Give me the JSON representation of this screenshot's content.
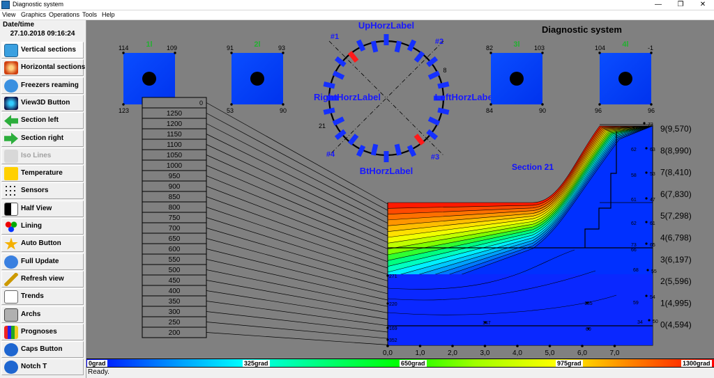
{
  "window": {
    "title": "Diagnostic system",
    "minimize": "—",
    "restore": "❐",
    "close": "✕"
  },
  "menu": [
    "View",
    "Graphics",
    "Operations",
    "Tools",
    "Help"
  ],
  "sidebar": {
    "datetime_label": "Date/time",
    "datetime_value": "27.10.2018 09:16:24",
    "buttons": [
      {
        "label": "Vertical sections",
        "icon": "vertical-sections-icon",
        "pressed": true
      },
      {
        "label": "Horizontal sections",
        "icon": "horizontal-sections-icon"
      },
      {
        "label": "Freezers reaming",
        "icon": "freezers-icon"
      },
      {
        "label": "View3D Button",
        "icon": "view3d-icon"
      },
      {
        "label": "Section left",
        "icon": "arrow-left-icon"
      },
      {
        "label": "Section right",
        "icon": "arrow-right-icon"
      },
      {
        "label": "Iso Lines",
        "icon": "iso-lines-icon",
        "disabled": true
      },
      {
        "label": "Temperature",
        "icon": "temperature-icon"
      },
      {
        "label": "Sensors",
        "icon": "sensors-icon"
      },
      {
        "label": "Half View",
        "icon": "half-view-icon"
      },
      {
        "label": "Lining",
        "icon": "lining-icon"
      },
      {
        "label": "Auto Button",
        "icon": "star-icon"
      },
      {
        "label": "Full Update",
        "icon": "refresh-icon"
      },
      {
        "label": "Refresh view",
        "icon": "wand-icon"
      },
      {
        "label": "Trends",
        "icon": "trends-icon"
      },
      {
        "label": "Archs",
        "icon": "archive-icon"
      },
      {
        "label": "Prognoses",
        "icon": "bar-chart-icon"
      },
      {
        "label": "Caps Button",
        "icon": "help-icon"
      },
      {
        "label": "Notch T",
        "icon": "info-icon"
      }
    ]
  },
  "diagram": {
    "title": "Diagnostic system",
    "section_label": "Section 21",
    "ring_labels": {
      "up": "UpHorzLabel",
      "bottom": "BtHorzLabel",
      "right": "RightHorzLabel",
      "left": "LeftHorzLabel"
    },
    "ring_markers": [
      "#1",
      "#2",
      "#3",
      "#4"
    ],
    "ring_red_sensors": [
      "8",
      "21"
    ],
    "panels": [
      {
        "label": "1l",
        "corners": [
          "114",
          "109",
          "123",
          "90"
        ]
      },
      {
        "label": "2l",
        "corners": [
          "91",
          "93",
          "53",
          "90"
        ]
      },
      {
        "label": "3l",
        "corners": [
          "82",
          "103",
          "84",
          "90"
        ]
      },
      {
        "label": "4l",
        "corners": [
          "104",
          "-1",
          "96",
          "96"
        ]
      }
    ],
    "iso_levels": [
      "1300",
      "1250",
      "1200",
      "1150",
      "1100",
      "1050",
      "1000",
      "950",
      "900",
      "850",
      "800",
      "750",
      "700",
      "650",
      "600",
      "550",
      "500",
      "450",
      "400",
      "350",
      "300",
      "250",
      "200"
    ],
    "iso_scale_top_visible": "0",
    "x_ticks": [
      "0,0",
      "1,0",
      "2,0",
      "3,0",
      "4,0",
      "5,0",
      "6,0",
      "7,0"
    ],
    "y_ticks": [
      "9(9,570)",
      "8(8,990)",
      "7(8,410)",
      "6(7,830)",
      "5(7,298)",
      "4(6,798)",
      "3(6,197)",
      "2(5,596)",
      "1(4,995)",
      "0(4,594)"
    ],
    "sensors_right": [
      "72",
      "63",
      "53",
      "47",
      "61",
      "65",
      "55",
      "54",
      "50"
    ],
    "sensors_inner": [
      "7",
      "62",
      "58",
      "61",
      "62",
      "73",
      "66",
      "68",
      "59",
      "34"
    ],
    "sensors_left": [
      "271",
      "220",
      "169",
      "352"
    ],
    "sensors_mid": [
      "147",
      "135",
      "60"
    ]
  },
  "colorbar": {
    "labels": [
      "0grad",
      "325grad",
      "650grad",
      "975grad",
      "1300grad"
    ]
  },
  "status": {
    "text": "Ready."
  }
}
